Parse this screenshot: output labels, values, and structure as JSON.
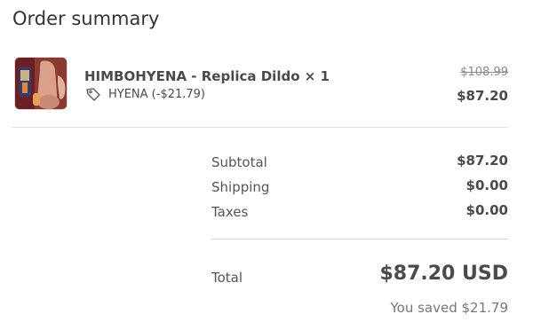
{
  "order_summary": {
    "title": "Order summary"
  },
  "line_item": {
    "thumbnail_icon": "product-image",
    "name": "HIMBOHYENA - Replica Dildo × 1",
    "discount_icon": "tag-icon",
    "discount_label": "HYENA (-$21.79)",
    "compare_at_price": "$108.99",
    "price": "$87.20"
  },
  "summary": {
    "subtotal_label": "Subtotal",
    "subtotal_value": "$87.20",
    "shipping_label": "Shipping",
    "shipping_value": "$0.00",
    "taxes_label": "Taxes",
    "taxes_value": "$0.00"
  },
  "total": {
    "label": "Total",
    "value": "$87.20 USD",
    "savings": "You saved $21.79"
  }
}
